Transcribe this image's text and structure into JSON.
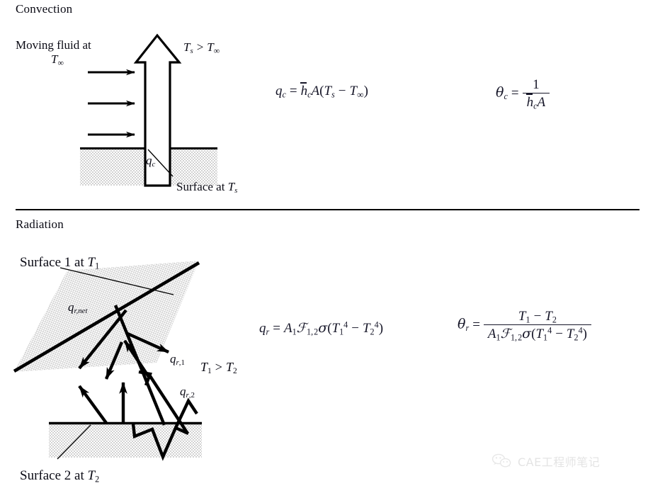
{
  "page": {
    "background": "#ffffff",
    "ink": "#000000",
    "stipple_gray": "#d8d8d8",
    "watermark_gray": "#e3e3e3"
  },
  "sections": [
    {
      "id": "convection",
      "title": "Convection"
    },
    {
      "id": "radiation",
      "title": "Radiation"
    }
  ],
  "convection": {
    "title": "Convection",
    "labels": {
      "moving_fluid": "Moving fluid at",
      "t_infinity": "T∞",
      "t_inequality": "Ts > T∞",
      "heat_flux": "qc",
      "surface": "Surface at Ts"
    },
    "equations": {
      "heat_rate": "qc = h̄c A ( Ts − T∞ )",
      "resistance": "θc = 1 / ( h̄c A )"
    },
    "diagram": {
      "flow_arrows": 3,
      "flow_arrow_direction": "right",
      "big_arrow_direction": "up",
      "big_arrow_style": "hollow-outline",
      "ground_fill": "stipple-gray"
    }
  },
  "radiation": {
    "title": "Radiation",
    "labels": {
      "surface1": "Surface 1 at T1",
      "surface2": "Surface 2 at T2",
      "q_net": "qr,net",
      "q_1": "qr,1",
      "q_2": "qr,2",
      "t_inequality": "T1 > T2"
    },
    "equations": {
      "heat_rate": "qr = A1 ℱ 1,2 σ ( T1⁴ − T2⁴ )",
      "resistance": "θr = ( T1 − T2 ) / ( A1 ℱ 1,2 σ ( T1⁴ − T2⁴ ) )"
    },
    "diagram": {
      "plate1": "tilted stippled plate (Surface 1)",
      "plate2": "horizontal stippled slab (Surface 2)",
      "ray_arrows": 8,
      "fill": "stipple-gray"
    }
  },
  "watermark": {
    "icon": "wechat-icon",
    "text": "CAE工程师笔记"
  }
}
